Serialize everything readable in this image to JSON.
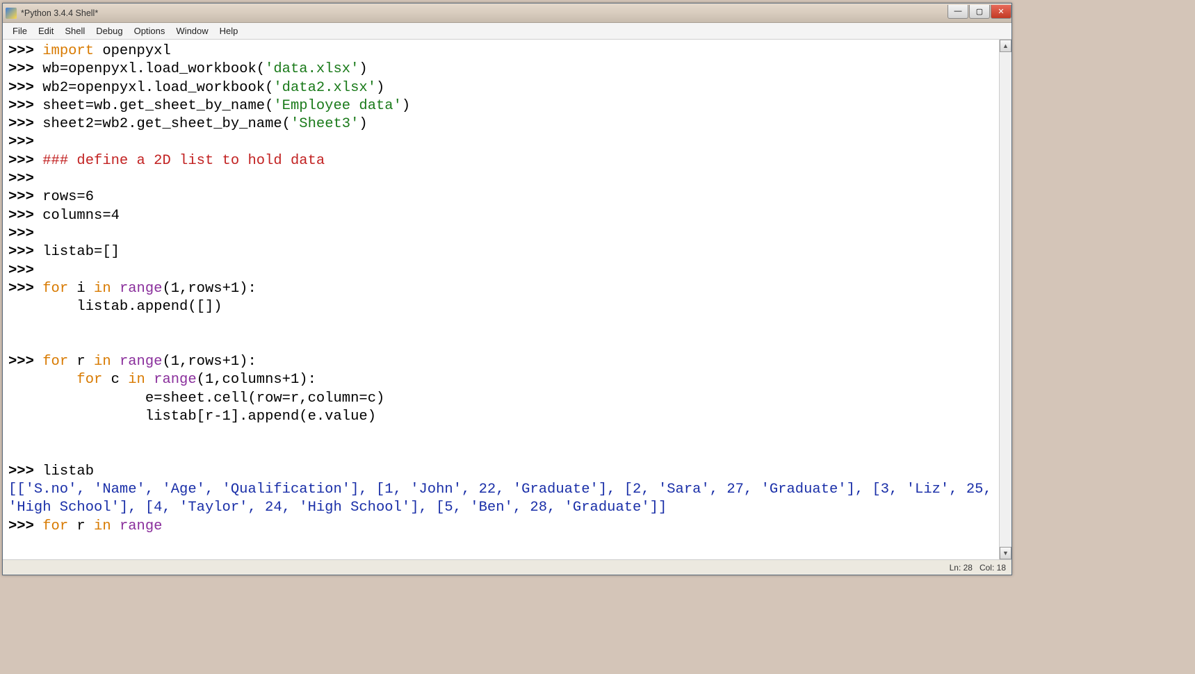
{
  "window": {
    "title": "*Python 3.4.4 Shell*"
  },
  "menu": {
    "items": [
      "File",
      "Edit",
      "Shell",
      "Debug",
      "Options",
      "Window",
      "Help"
    ]
  },
  "status": {
    "ln": "Ln: 28",
    "col": "Col: 18"
  },
  "winbuttons": {
    "min": "—",
    "max": "▢",
    "close": "✕"
  },
  "scroll": {
    "up": "▲",
    "down": "▼"
  },
  "code": {
    "prompt": ">>> ",
    "blank": "",
    "l1_import": "import",
    "l1_rest": " openpyxl",
    "l2": "wb=openpyxl.load_workbook(",
    "l2_str": "'data.xlsx'",
    "l2_end": ")",
    "l3": "wb2=openpyxl.load_workbook(",
    "l3_str": "'data2.xlsx'",
    "l3_end": ")",
    "l4": "sheet=wb.get_sheet_by_name(",
    "l4_str": "'Employee data'",
    "l4_end": ")",
    "l5": "sheet2=wb2.get_sheet_by_name(",
    "l5_str": "'Sheet3'",
    "l5_end": ")",
    "l_comment": "### define a 2D list to hold data",
    "l_rows": "rows=6",
    "l_cols": "columns=4",
    "l_listab": "listab=[]",
    "f1_for": "for",
    "f1_i": " i ",
    "f1_in": "in",
    "f1_range": " range",
    "f1_args": "(1,rows+1):",
    "f1_body": "        listab.append([])",
    "f2_for": "for",
    "f2_r": " r ",
    "f2_in": "in",
    "f2_range": " range",
    "f2_args": "(1,rows+1):",
    "f2b_indent": "        ",
    "f2b_for": "for",
    "f2b_c": " c ",
    "f2b_in": "in",
    "f2b_range": " range",
    "f2b_args": "(1,columns+1):",
    "f2_body1": "                e=sheet.cell(row=r,column=c)",
    "f2_body2": "                listab[r-1].append(e.value)",
    "l_listabcall": "listab",
    "output": "[['S.no', 'Name', 'Age', 'Qualification'], [1, 'John', 22, 'Graduate'], [2, 'Sara', 27, 'Graduate'], [3, 'Liz', 25, 'High School'], [4, 'Taylor', 24, 'High School'], [5, 'Ben', 28, 'Graduate']]",
    "last_for": "for",
    "last_r": " r ",
    "last_in": "in",
    "last_range": " range"
  }
}
